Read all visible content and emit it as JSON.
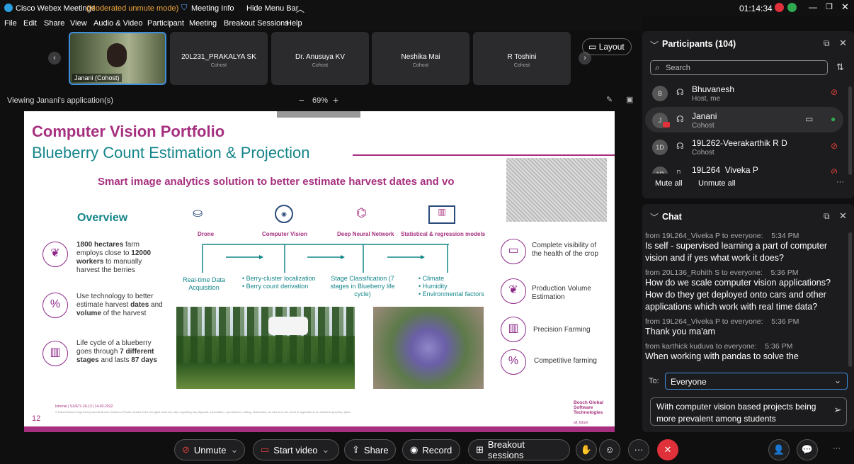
{
  "titlebar": {
    "app": "Cisco Webex Meetings",
    "mode": "(Moderated unmute mode)",
    "meeting_info": "Meeting Info",
    "hide_menu": "Hide Menu Bar",
    "time": "01:14:34"
  },
  "menu": [
    "File",
    "Edit",
    "Share",
    "View",
    "Audio & Video",
    "Participant",
    "Meeting",
    "Breakout Sessions",
    "Help"
  ],
  "tiles": [
    {
      "name": "Janani (Cohost)"
    },
    {
      "name": "20L231_PRAKALYA SK",
      "role": "Cohost"
    },
    {
      "name": "Dr. Anusuya KV",
      "role": "Cohost"
    },
    {
      "name": "Neshika Mai",
      "role": "Cohost"
    },
    {
      "name": "R Toshini",
      "role": "Cohost"
    }
  ],
  "layout_label": "Layout",
  "viewing": "Viewing Janani's application(s)",
  "zoom": "69%",
  "slide": {
    "title": "Computer Vision Portfolio",
    "subtitle": "Blueberry Count Estimation & Projection",
    "tagline": "Smart image analytics solution to better estimate harvest dates and vo",
    "overview": "Overview",
    "steps": [
      "Drone",
      "Computer Vision",
      "Deep Neural Network",
      "Statistical & regression models"
    ],
    "step_desc": [
      "Real-time Data Acquisition",
      "• Berry-cluster localization\n• Berry count derivation",
      "Stage Classification (7 stages in Blueberry life cycle)",
      "• Climate\n• Humidity\n• Environmental factors"
    ],
    "left_facts": [
      {
        "pre": "",
        "b1": "1800 hectares",
        "mid": " farm employs close to ",
        "b2": "12000 workers",
        "post": " to manually harvest the berries"
      },
      {
        "pre": "Use technology to better estimate harvest ",
        "b1": "dates",
        "mid": " and ",
        "b2": "volume",
        "post": " of the harvest"
      },
      {
        "pre": "Life cycle of a blueberry goes through ",
        "b1": "7 different stages",
        "mid": " and lasts ",
        "b2": "87 days",
        "post": ""
      }
    ],
    "right_feats": [
      "Complete visibility of the health of the crop",
      "Production Volume Estimation",
      "Precision Farming",
      "Competitive farming"
    ],
    "footer_tag": "Internal | SX/ETL-DL13 | 14-03-2022",
    "footer_copy": "© Robert Bosch Engineering and Business Solutions Private Limited 2018. All rights reserved, also regarding any disposal, exploitation, reproduction, editing, distribution, as well as in the event of applications for industrial property rights.",
    "page": "12",
    "brand": "Bosch Global Software Technologies",
    "brand_tag": "all_future"
  },
  "participants": {
    "title": "Participants (104)",
    "search_placeholder": "Search",
    "rows": [
      {
        "initials": "B",
        "name": "Bhuvanesh",
        "role": "Host, me"
      },
      {
        "initials": "J",
        "name": "Janani",
        "role": "Cohost"
      },
      {
        "initials": "1D",
        "name": "19L262-Veerakarthik R D",
        "role": "Cohost"
      },
      {
        "initials": "1P",
        "name": "19L264_Viveka P",
        "role": ""
      }
    ],
    "mute_all": "Mute all",
    "unmute_all": "Unmute all"
  },
  "chat": {
    "title": "Chat",
    "messages": [
      {
        "from": "from 19L264_Viveka P to everyone:",
        "time": "5:34 PM",
        "text": "Is self - supervised learning a part of computer vision and if yes what work it does?"
      },
      {
        "from": "from 20L136_Rohith S to everyone:",
        "time": "5:36 PM",
        "text": " How do we scale computer vision applications? How do they get deployed onto cars and other applications which work with real time data?"
      },
      {
        "from": "from 19L264_Viveka P to everyone:",
        "time": "5:36 PM",
        "text": "Thank you ma'am"
      },
      {
        "from": "from karthick kuduva to everyone:",
        "time": "5:36 PM",
        "text": "When working with pandas to solve the"
      }
    ],
    "to_label": "To:",
    "to_value": "Everyone",
    "draft": "With computer vision based projects being more prevalent among students"
  },
  "controls": {
    "unmute": "Unmute",
    "start_video": "Start video",
    "share": "Share",
    "record": "Record",
    "breakout": "Breakout sessions"
  }
}
